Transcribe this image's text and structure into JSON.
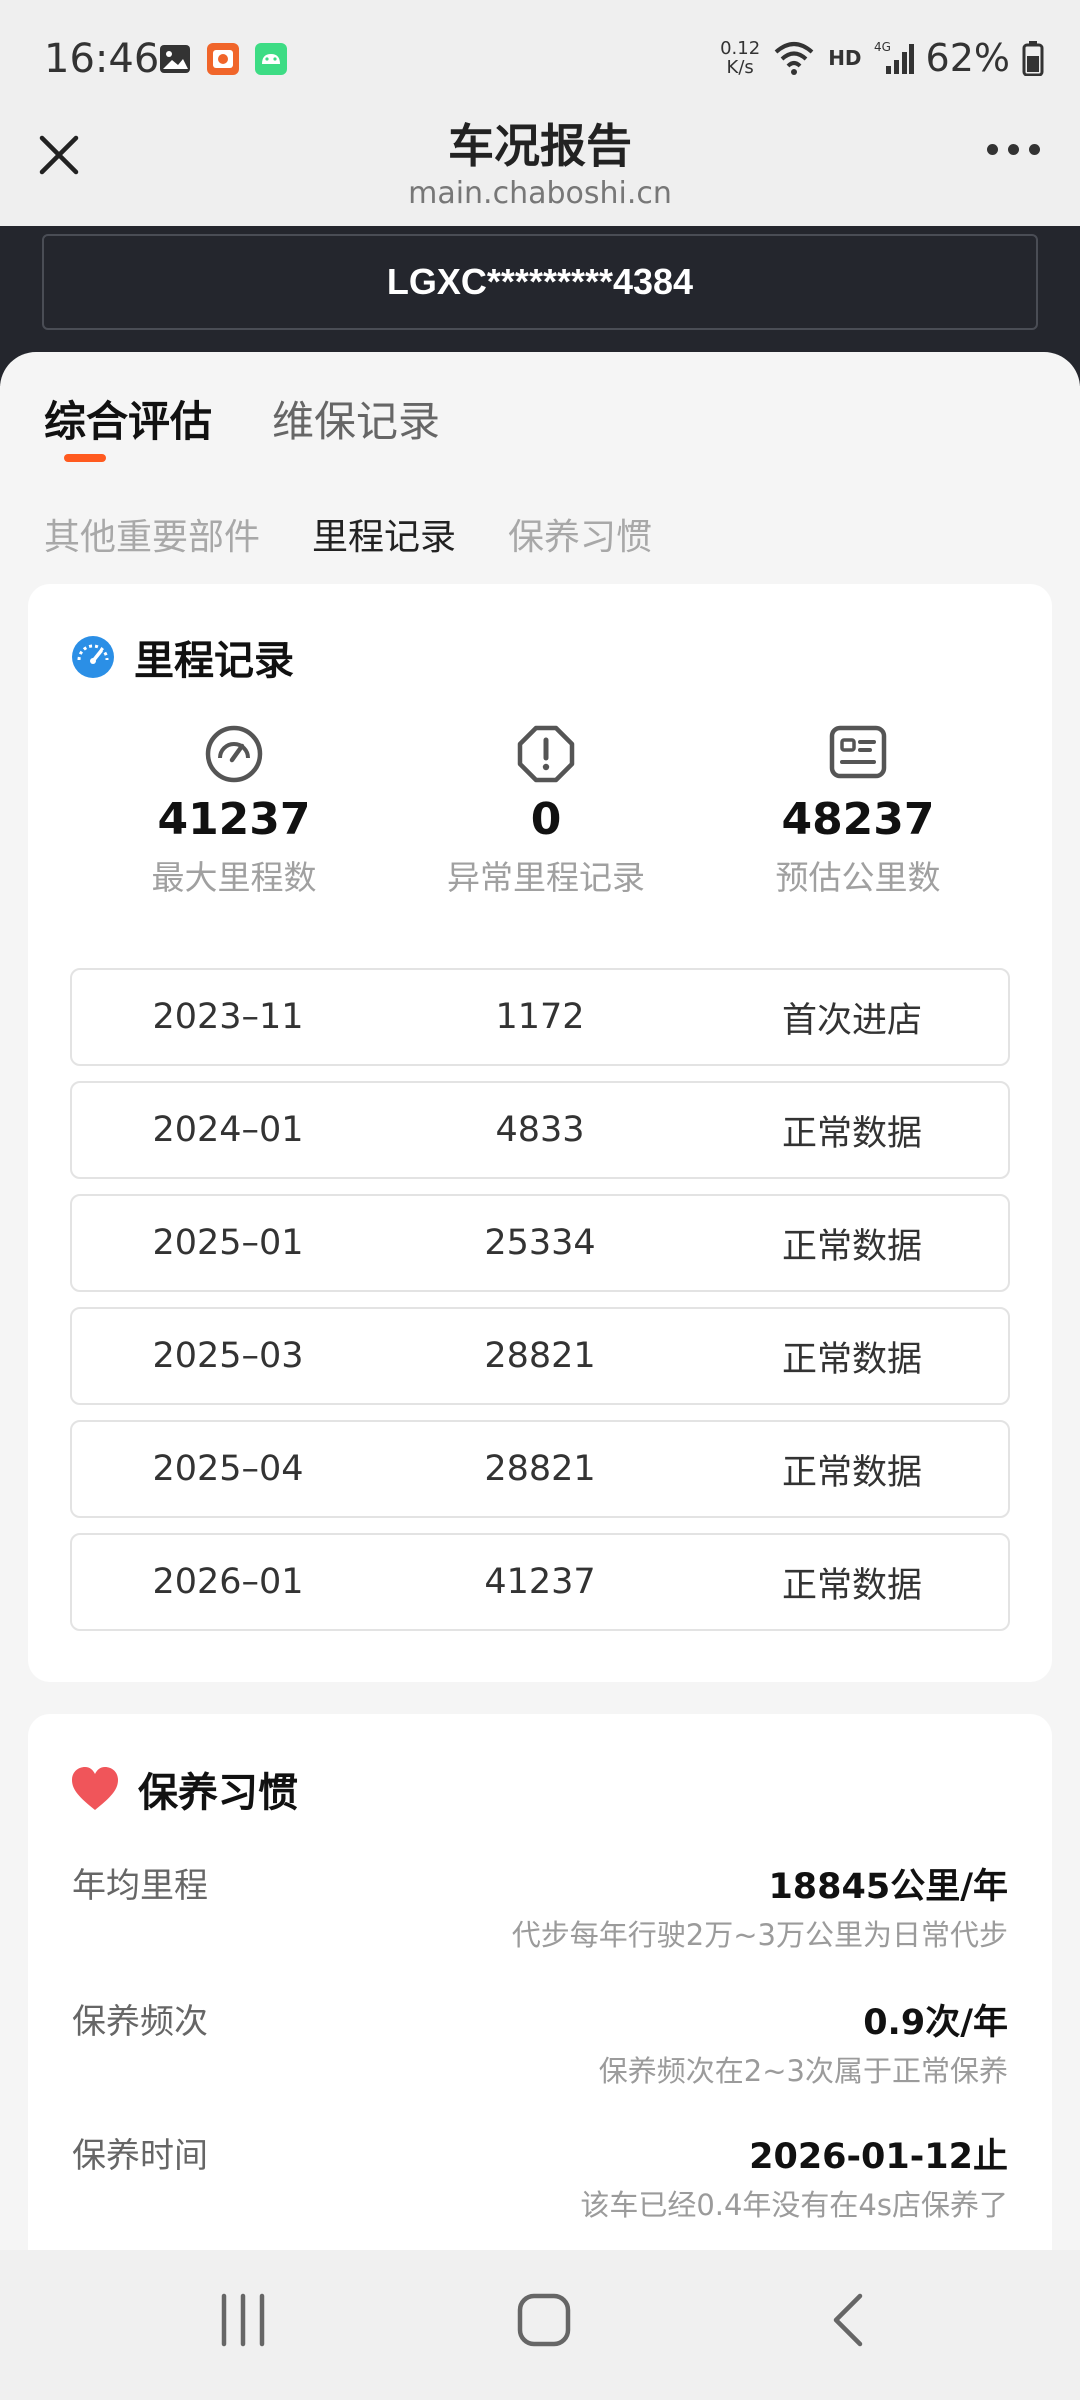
{
  "status_bar": {
    "time": "16:46",
    "speed_value": "0.12",
    "speed_unit": "K/s",
    "hd_label": "HD",
    "network_label": "4G",
    "battery": "62%"
  },
  "nav": {
    "title": "车况报告",
    "subtitle": "main.chaboshi.cn"
  },
  "vin": "LGXC*********4384",
  "tabs": [
    {
      "label": "综合评估"
    },
    {
      "label": "维保记录"
    }
  ],
  "subtabs": [
    {
      "label": "其他重要部件"
    },
    {
      "label": "里程记录"
    },
    {
      "label": "保养习惯"
    }
  ],
  "mileage_card": {
    "title": "里程记录",
    "stats": [
      {
        "value": "41237",
        "label": "最大里程数",
        "icon": "speedometer-icon"
      },
      {
        "value": "0",
        "label": "异常里程记录",
        "icon": "alert-octagon-icon"
      },
      {
        "value": "48237",
        "label": "预估公里数",
        "icon": "id-card-icon"
      }
    ],
    "records": [
      {
        "date": "2023–11",
        "mileage": "1172",
        "status": "首次进店"
      },
      {
        "date": "2024–01",
        "mileage": "4833",
        "status": "正常数据"
      },
      {
        "date": "2025–01",
        "mileage": "25334",
        "status": "正常数据"
      },
      {
        "date": "2025–03",
        "mileage": "28821",
        "status": "正常数据"
      },
      {
        "date": "2025–04",
        "mileage": "28821",
        "status": "正常数据"
      },
      {
        "date": "2026–01",
        "mileage": "41237",
        "status": "正常数据"
      }
    ]
  },
  "habit_card": {
    "title": "保养习惯",
    "items": [
      {
        "label": "年均里程",
        "value": "18845公里/年",
        "note": "代步每年行驶2万~3万公里为日常代步"
      },
      {
        "label": "保养频次",
        "value": "0.9次/年",
        "note": "保养频次在2~3次属于正常保养"
      },
      {
        "label": "保养时间",
        "value": "2026-01-12止",
        "note": "该车已经0.4年没有在4s店保养了"
      }
    ]
  },
  "colors": {
    "accent": "#ff5a1f",
    "vin_bg": "#24262d",
    "heart": "#f0555a",
    "gauge_blue": "#2b8fe6"
  }
}
